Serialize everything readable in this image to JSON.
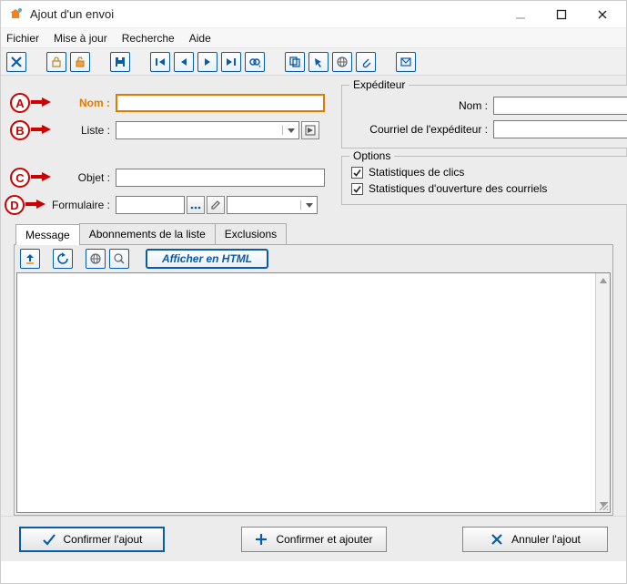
{
  "window": {
    "title": "Ajout d'un envoi"
  },
  "menu": {
    "file": "Fichier",
    "update": "Mise à jour",
    "search": "Recherche",
    "help": "Aide"
  },
  "annotations": {
    "a": "A",
    "b": "B",
    "c": "C",
    "d": "D"
  },
  "form": {
    "nom_label": "Nom :",
    "nom_value": "",
    "liste_label": "Liste :",
    "liste_value": "",
    "objet_label": "Objet :",
    "objet_value": "",
    "formulaire_label": "Formulaire :",
    "formulaire_value": "",
    "formulaire_combo_value": ""
  },
  "expediteur": {
    "legend": "Expéditeur",
    "nom_label": "Nom :",
    "nom_value": "",
    "courriel_label": "Courriel de l'expéditeur :",
    "courriel_value": ""
  },
  "options": {
    "legend": "Options",
    "stats_clics": "Statistiques de clics",
    "stats_ouverture": "Statistiques d'ouverture des courriels",
    "stats_clics_checked": true,
    "stats_ouverture_checked": true
  },
  "tabs": {
    "message": "Message",
    "abonnements": "Abonnements de la liste",
    "exclusions": "Exclusions"
  },
  "message_panel": {
    "afficher_html_label": "Afficher en HTML"
  },
  "footer": {
    "confirm": "Confirmer l'ajout",
    "confirm_add": "Confirmer et ajouter",
    "cancel": "Annuler l'ajout"
  }
}
